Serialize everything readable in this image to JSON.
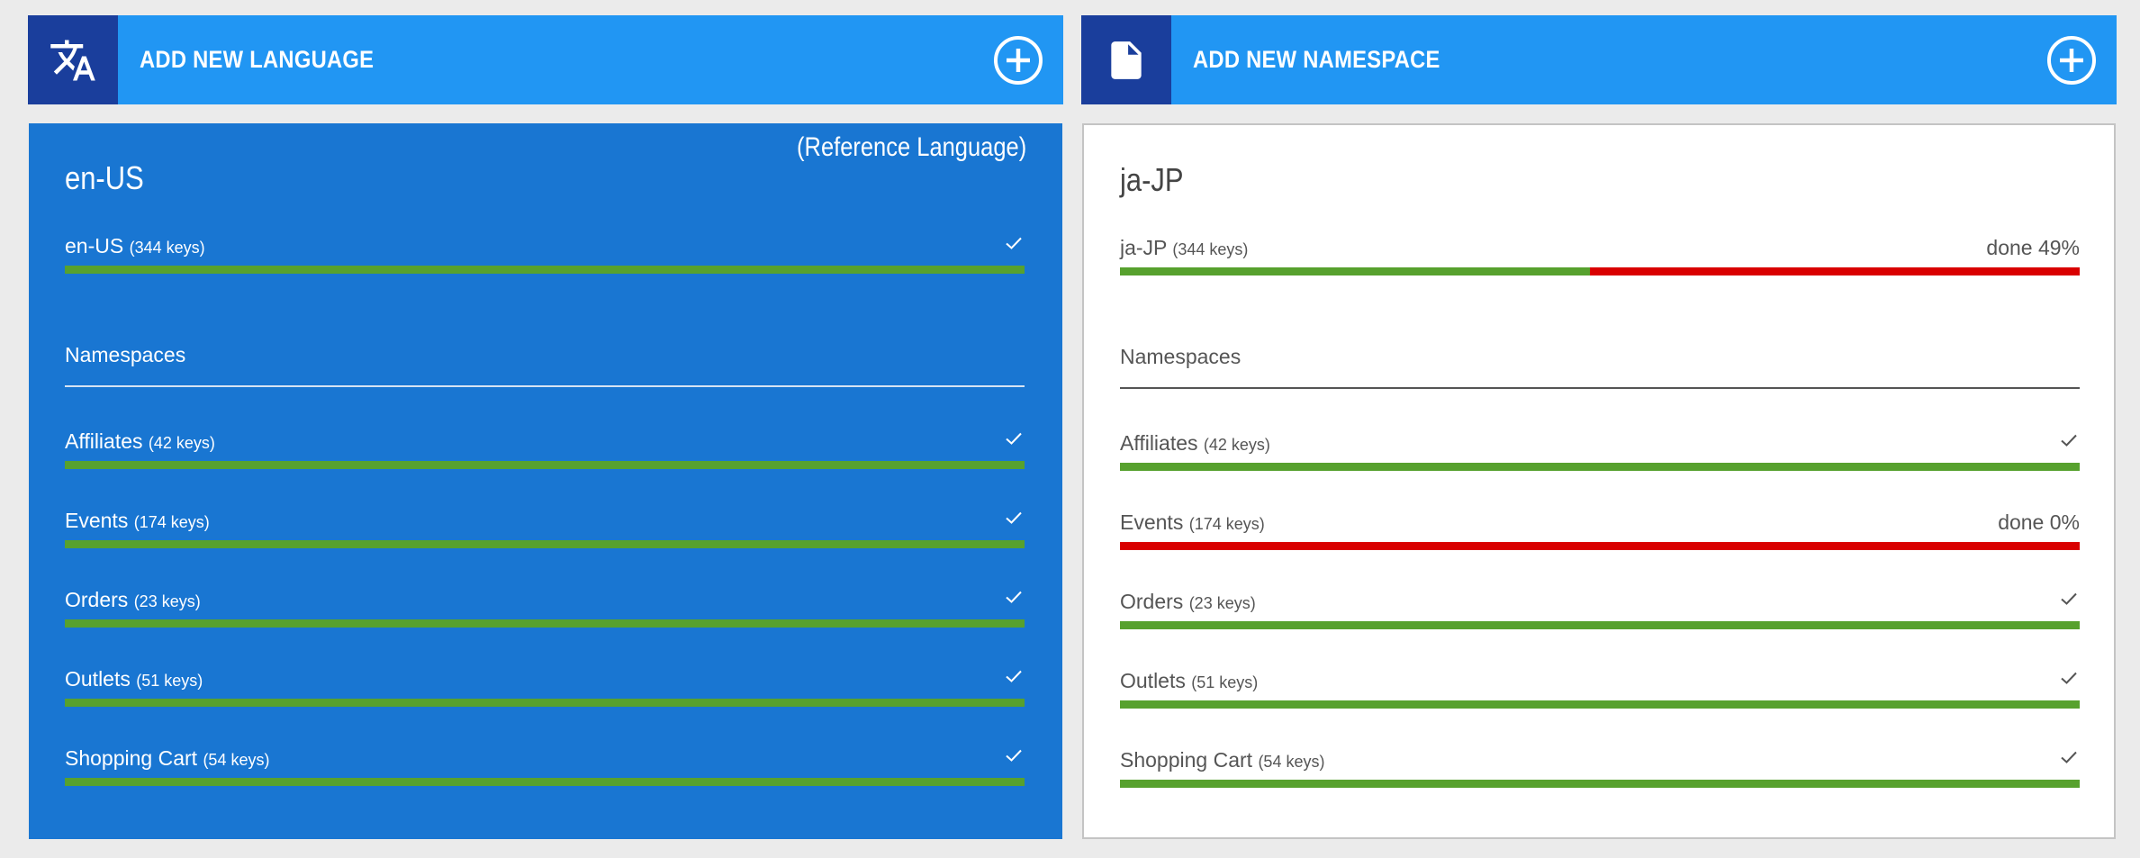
{
  "left_panel": {
    "add_label": "ADD NEW LANGUAGE",
    "icon": "translate-icon",
    "card": {
      "tag": "(Reference Language)",
      "title": "en-US",
      "main": {
        "name": "en-US",
        "keys": "(344 keys)",
        "progress": 1.0,
        "status": "check"
      },
      "namespaces_label": "Namespaces",
      "namespaces": [
        {
          "name": "Affiliates",
          "keys": "(42 keys)",
          "progress": 1.0,
          "status": "check"
        },
        {
          "name": "Events",
          "keys": "(174 keys)",
          "progress": 1.0,
          "status": "check"
        },
        {
          "name": "Orders",
          "keys": "(23 keys)",
          "progress": 1.0,
          "status": "check"
        },
        {
          "name": "Outlets",
          "keys": "(51 keys)",
          "progress": 1.0,
          "status": "check"
        },
        {
          "name": "Shopping Cart",
          "keys": "(54 keys)",
          "progress": 1.0,
          "status": "check"
        }
      ]
    }
  },
  "right_panel": {
    "add_label": "ADD NEW NAMESPACE",
    "icon": "document-icon",
    "card": {
      "title": "ja-JP",
      "main": {
        "name": "ja-JP",
        "keys": "(344 keys)",
        "progress": 0.49,
        "status": "done 49%"
      },
      "namespaces_label": "Namespaces",
      "namespaces": [
        {
          "name": "Affiliates",
          "keys": "(42 keys)",
          "progress": 1.0,
          "status": "check"
        },
        {
          "name": "Events",
          "keys": "(174 keys)",
          "progress": 0.0,
          "status": "done 0%"
        },
        {
          "name": "Orders",
          "keys": "(23 keys)",
          "progress": 1.0,
          "status": "check"
        },
        {
          "name": "Outlets",
          "keys": "(51 keys)",
          "progress": 1.0,
          "status": "check"
        },
        {
          "name": "Shopping Cart",
          "keys": "(54 keys)",
          "progress": 1.0,
          "status": "check"
        }
      ]
    }
  },
  "colors": {
    "bar_blue": "#2196f3",
    "icon_box": "#1a3e9c",
    "ref_card": "#1976d2",
    "done": "#57a12e",
    "missing": "#d90000"
  }
}
